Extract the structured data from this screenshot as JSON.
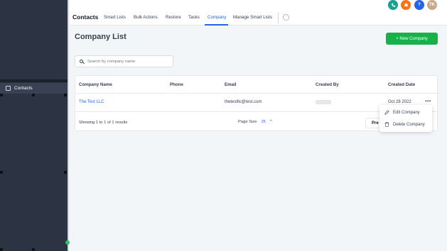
{
  "sidebar": {
    "items": [
      {
        "label": "Contacts",
        "icon": "contacts-icon"
      }
    ]
  },
  "header": {
    "title": "Contacts",
    "tabs": [
      {
        "label": "Smart Lists",
        "active": false
      },
      {
        "label": "Bulk Actions",
        "active": false
      },
      {
        "label": "Restore",
        "active": false
      },
      {
        "label": "Tasks",
        "active": false
      },
      {
        "label": "Company",
        "active": true
      },
      {
        "label": "Manage Smart Lists",
        "active": false
      }
    ],
    "settings_icon": "gear-icon",
    "top_icons": [
      {
        "name": "phone-icon",
        "color": "#16a394"
      },
      {
        "name": "bell-icon",
        "color": "#f97316"
      },
      {
        "name": "help-icon",
        "label": "?",
        "color": "#2563eb"
      },
      {
        "name": "user-avatar",
        "label": "TK",
        "color": "#c9a98a"
      }
    ]
  },
  "page": {
    "title": "Company List",
    "new_button_label": "+ New Company",
    "search_placeholder": "Search by company name"
  },
  "table": {
    "columns": [
      "Company Name",
      "Phone",
      "Email",
      "Created By",
      "Created Date"
    ],
    "rows": [
      {
        "company_name": "The Test LLC",
        "phone": "",
        "email": "thetestllc@test.com",
        "created_by": "",
        "created_date": "Oct 28 2022"
      }
    ],
    "footer": {
      "showing": "Showing 1 to 1 of 1 results",
      "page_size_label": "Page Size",
      "page_size_value": "25",
      "prev_label": "Pre"
    }
  },
  "row_menu": {
    "items": [
      {
        "label": "Edit Company",
        "icon": "pencil-icon"
      },
      {
        "label": "Delete Company",
        "icon": "trash-icon"
      }
    ]
  },
  "colors": {
    "accent": "#2563eb",
    "primary_button": "#16b249",
    "sidebar": "#2c3443"
  }
}
